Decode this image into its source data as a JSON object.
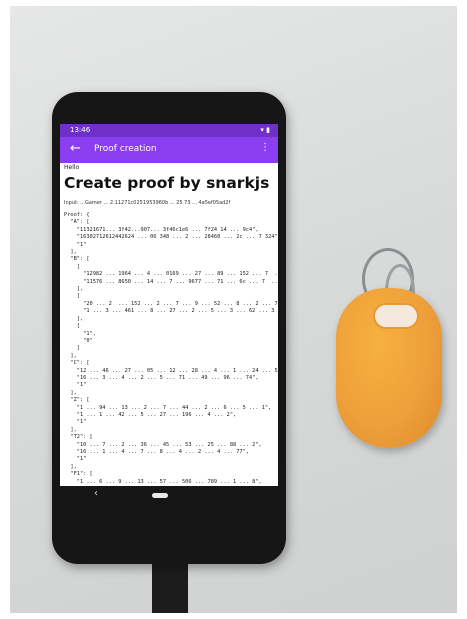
{
  "status_bar": {
    "time": "13:46",
    "icons": "▾ ▮"
  },
  "app_bar": {
    "back_icon": "arrow-back-icon",
    "title": "Proof creation",
    "menu_icon": "more-vert-icon"
  },
  "content": {
    "hello": "Hello",
    "heading": "Create proof by snarkjs",
    "input_line": "Input: ...Gamer ... 2.11271c0251953960b ... 25 73 ... 4a5ef05ad2f",
    "proof_text": "Proof: {\n  \"A\": [\n    \"11321671... 3f42...907... 3f46c1e6 ... 7f24 14 ... 9c4\",\n    \"16302712612442624 ... 06 348 ... 2 ... 28460 ... 2c ... 7 324\",\n    \"1\"\n  ],\n  \"B\": [\n    [\n      \"12982 ... 1964 ... 4 ... 0169 ... 27 ... 89 ... 152 ... 7  ... 37\",\n      \"11576 ... 8650 ... 14 ... 7 ... 9677 ... 71 ... 6c ... 7  ... 18\"\n    ],\n    [\n      \"20 ... 2  ... 152 ... 2 ... 7 ... 9 ... 52 ... 8 ... 2 ... 73 ... 2\",\n      \"1 ... 3 ... 461 ... 8 ... 27 ... 2 ... 5 ... 3 ... 62 ... 3 ... 52\"\n    ],\n    [\n      \"1\",\n      \"0\"\n    ]\n  ],\n  \"C\": [\n    \"12 ... 46 ... 27 ... 05 ... 12 ... 28 ... 4 ... 1 ... 24 ... 5\",\n    \"16 ... 3 ... 4 ... 2 ... 5 ... 71 ... 49 ... 96 ... 74\",\n    \"1\"\n  ],\n  \"Z\": [\n    \"1 ... 94 ... 13 ... 2 ... 7 ... 44 ... 2 ... 6 ... 5 ... 1\",\n    \"1 ... 1 ... 42 ... 5 ... 27 ... 196 ... 4 ... 2\",\n    \"1\"\n  ],\n  \"T2\": [\n    \"10 ... 7 ... 2 ... 36 ... 45 ... 53 ... 25 ... 88 ... 2\",\n    \"16 ... 1 ... 4 ... 7 ... 8 ... 4 ... 2 ... 4 ... 77\",\n    \"1\"\n  ],\n  \"F1\": [\n    \"1 ... 6 ... 9 ... 13 ... 57 ... 506 ... 789 ... 1 ... 8\",\n    \"13 ... 647 ... 7 ... 15 ... 86 ... 6 ... 25 ... 3\",\n    \"1\"\n  ]\n}"
  },
  "nav_bar": {
    "back_icon": "nav-back-icon",
    "home_icon": "nav-home-icon"
  },
  "scene": {
    "fob_color": "#ee9f37",
    "appbar_color": "#8b3df0",
    "statusbar_color": "#6f30c8"
  }
}
